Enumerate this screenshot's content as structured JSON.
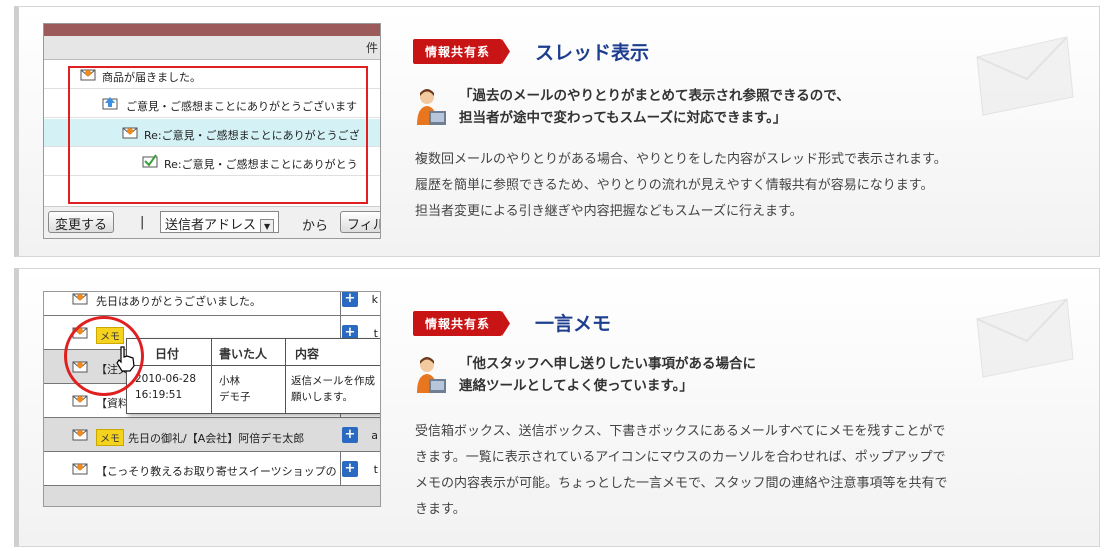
{
  "sections": [
    {
      "tag": "情報共有系",
      "title": "スレッド表示",
      "quote_line1": "「過去のメールのやりとりがまとめて表示され参照できるので、",
      "quote_line2": "担当者が途中で変わってもスムーズに対応できます。」",
      "desc_line1": "複数回メールのやりとりがある場合、やりとりをした内容がスレッド形式で表示されます。",
      "desc_line2": "履歴を簡単に参照できるため、やりとりの流れが見えやすく情報共有が容易になります。",
      "desc_line3": "担当者変更による引き継ぎや内容把握などもスムーズに行えます。",
      "screenshot": {
        "header_char": "件",
        "rows": [
          "商品が届きました。",
          "ご意見・ご感想まことにありがとうございます",
          "Re:ご意見・ご感想まことにありがとうござ",
          "Re:ご意見・ご感想まことにありがとう"
        ],
        "change_button": "変更する",
        "separator": "|",
        "select_value": "送信者アドレス",
        "from_text": "から",
        "filter_button": "フィル"
      }
    },
    {
      "tag": "情報共有系",
      "title": "一言メモ",
      "quote_line1": "「他スタッフへ申し送りしたい事項がある場合に",
      "quote_line2": "連絡ツールとしてよく使っています。」",
      "desc_line1": "受信箱ボックス、送信ボックス、下書きボックスにあるメールすべてにメモを残すことがで",
      "desc_line2": "きます。一覧に表示されているアイコンにマウスのカーソルを合わせれば、ポップアップで",
      "desc_line3": "メモの内容表示が可能。ちょっとした一言メモで、スタッフ間の連絡や注意事項等を共有で",
      "desc_line4": "きます。",
      "screenshot": {
        "rows": [
          "先日はありがとうございました。",
          "",
          "【注文",
          "【資料",
          "先日の御礼/【A会社】阿倍デモ太郎",
          "【こっそり教えるお取り寄せスイーツショップの"
        ],
        "memo_label": "メモ",
        "side_texts": [
          "k",
          "t",
          "",
          "",
          "a",
          "t"
        ],
        "popup": {
          "h_date": "日付",
          "h_author": "書いた人",
          "h_content": "内容",
          "date": "2010-06-28",
          "time": "16:19:51",
          "author1": "小林",
          "author2": "デモ子",
          "content1": "返信メールを作成",
          "content2": "願いします。"
        }
      }
    }
  ],
  "colors": {
    "tag_red": "#c81414",
    "title_blue": "#1d3d8f",
    "highlight_red": "#e02020",
    "thread_highlight": "#d4f2f6",
    "plus_blue": "#2a6ac0",
    "memo_yellow": "#f4d21e"
  },
  "icons": [
    "mail-envelope-icon",
    "reply-up-icon",
    "check-mail-icon",
    "person-pc-icon",
    "plus-icon",
    "hand-cursor-icon",
    "large-envelope-icon"
  ]
}
